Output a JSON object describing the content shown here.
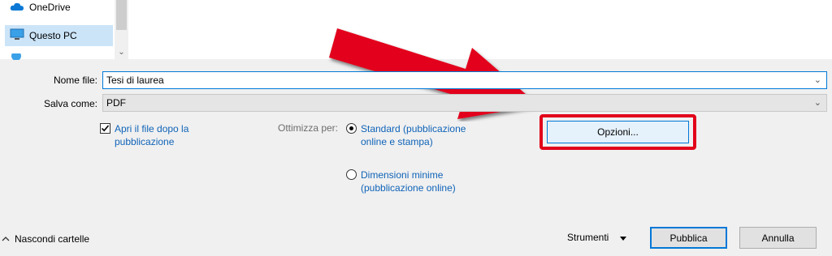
{
  "nav": {
    "items": [
      {
        "label": "OneDrive",
        "icon": "cloud-icon"
      },
      {
        "label": "Questo PC",
        "icon": "computer-icon"
      },
      {
        "label": "",
        "icon": "network-icon"
      }
    ]
  },
  "form": {
    "filename_label": "Nome file:",
    "filename_value": "Tesi di laurea",
    "savetype_label": "Salva come:",
    "savetype_value": "PDF"
  },
  "options": {
    "open_after_label": "Apri il file dopo la pubblicazione",
    "open_after_checked": true,
    "optimize_label": "Ottimizza per:",
    "standard_label": "Standard (pubblicazione online e stampa)",
    "minimal_label": "Dimensioni minime (pubblicazione online)",
    "selected": "standard",
    "options_button_label": "Opzioni..."
  },
  "footer": {
    "hide_folders_label": "Nascondi cartelle",
    "tools_label": "Strumenti",
    "publish_label": "Pubblica",
    "cancel_label": "Annulla"
  },
  "colors": {
    "accent": "#0078d7",
    "highlight_red": "#e2001a",
    "link_blue": "#0f63b8"
  }
}
